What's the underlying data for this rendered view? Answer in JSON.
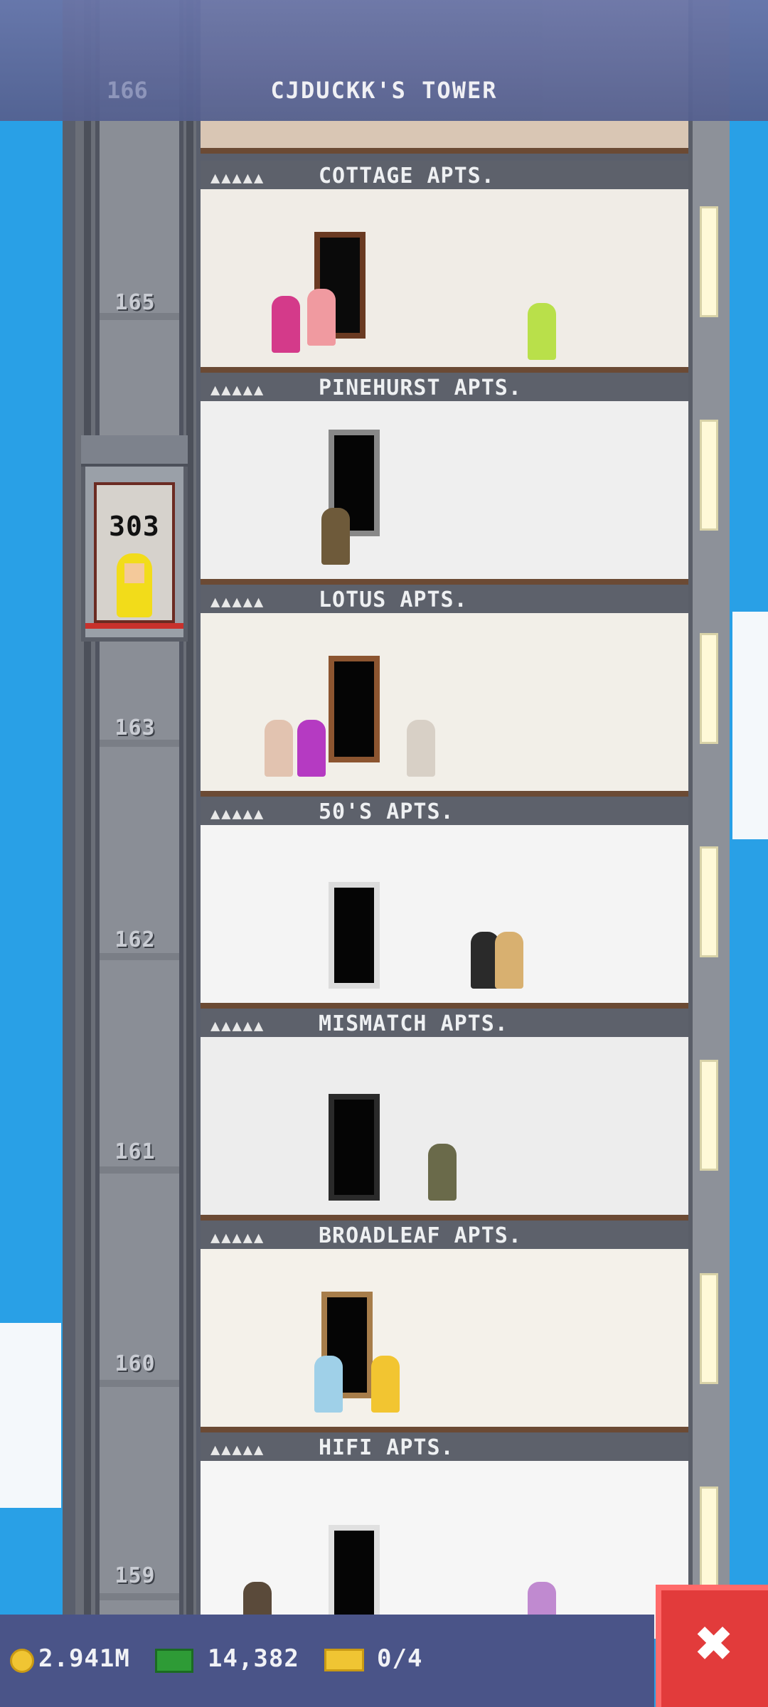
{
  "header": {
    "title": "CJDUCKK'S TOWER",
    "top_floor_number": "166"
  },
  "elevator": {
    "label": "303"
  },
  "shaft_floor_numbers": [
    {
      "floor": "165"
    },
    {
      "floor": "163"
    },
    {
      "floor": "162"
    },
    {
      "floor": "161"
    },
    {
      "floor": "160"
    },
    {
      "floor": "159"
    }
  ],
  "floors": [
    {
      "stars": "▲▲▲▲▲",
      "name": "COTTAGE APTS."
    },
    {
      "stars": "▲▲▲▲▲",
      "name": "PINEHURST APTS."
    },
    {
      "stars": "▲▲▲▲▲",
      "name": "LOTUS APTS."
    },
    {
      "stars": "▲▲▲▲▲",
      "name": "50'S APTS."
    },
    {
      "stars": "▲▲▲▲▲",
      "name": "MISMATCH APTS."
    },
    {
      "stars": "▲▲▲▲▲",
      "name": "BROADLEAF APTS."
    },
    {
      "stars": "▲▲▲▲▲",
      "name": "HIFI APTS."
    }
  ],
  "hud": {
    "coins": "2.941M",
    "bux": "14,382",
    "tickets": "0/4"
  },
  "icons": {
    "coin": "coin-icon",
    "bux": "bux-icon",
    "ticket": "ticket-icon",
    "close": "close-icon"
  },
  "colors": {
    "sky": "#29a0e6",
    "hud_bar": "#4a5488",
    "close_button": "#e23b3b"
  }
}
